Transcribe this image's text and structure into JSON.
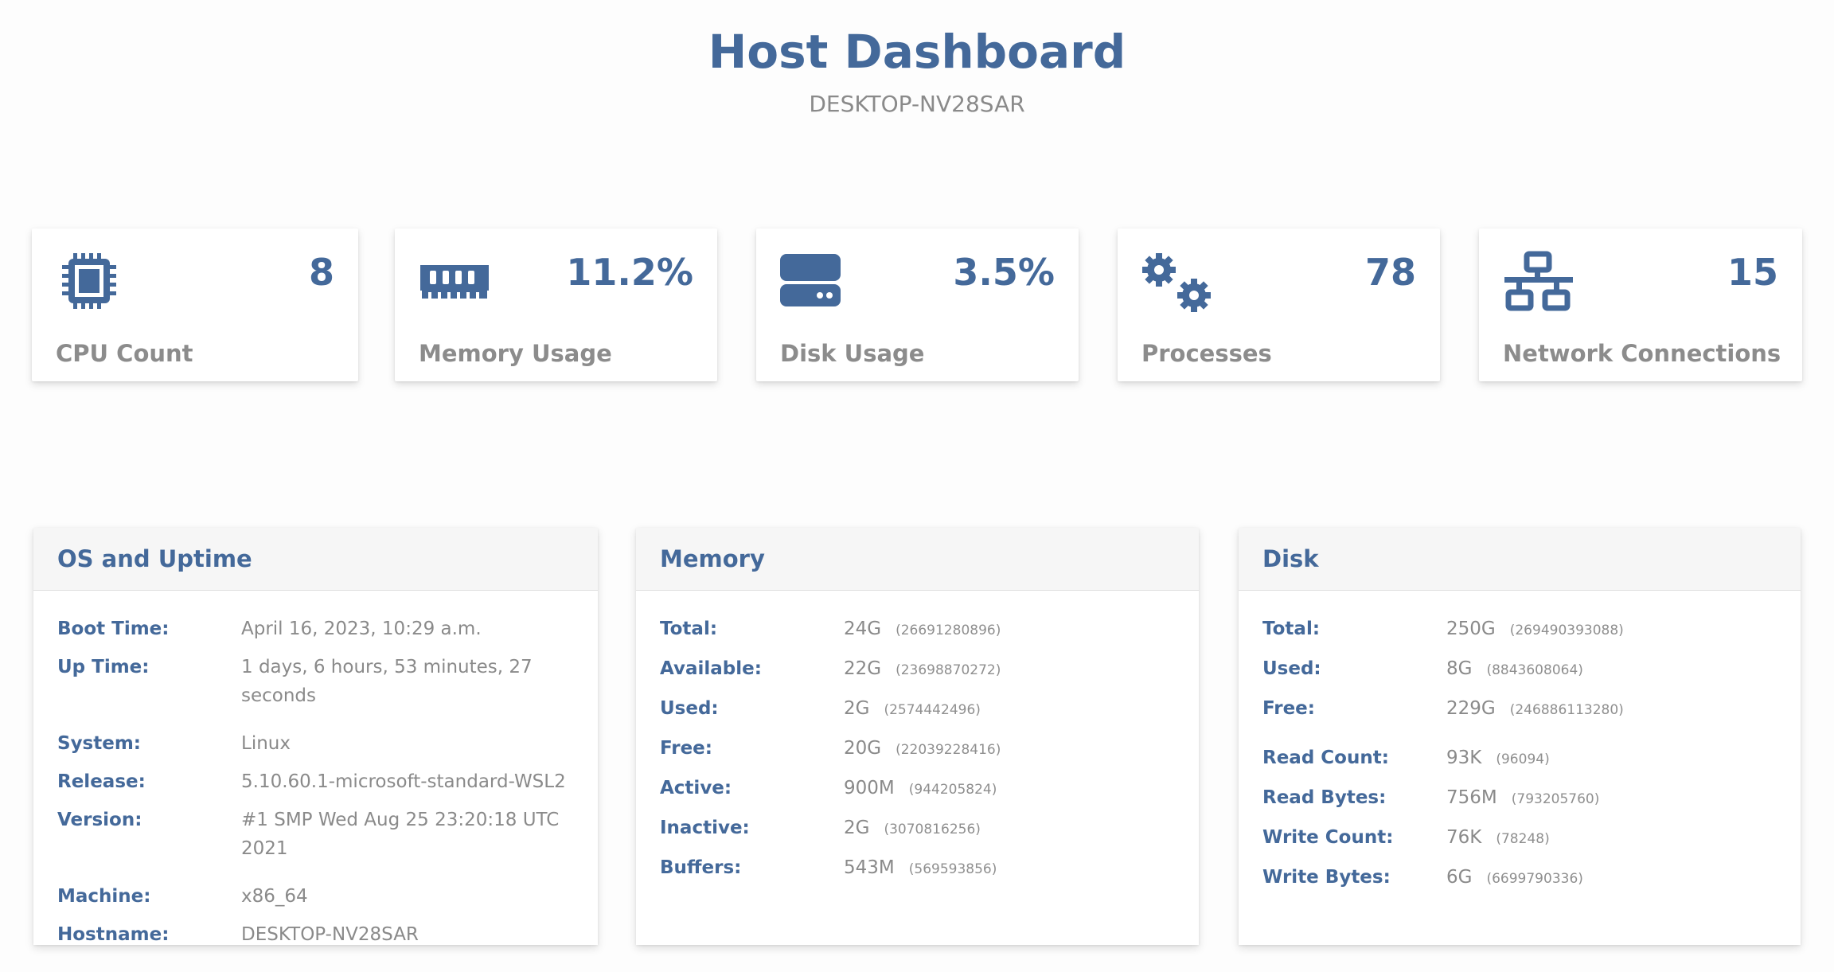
{
  "header": {
    "title": "Host Dashboard",
    "hostname": "DESKTOP-NV28SAR"
  },
  "colors": {
    "accent": "#44699a",
    "muted": "#8a8a8a"
  },
  "stats": [
    {
      "icon": "cpu-icon",
      "value": "8",
      "label": "CPU Count"
    },
    {
      "icon": "memory-icon",
      "value": "11.2%",
      "label": "Memory Usage"
    },
    {
      "icon": "hard-drive-icon",
      "value": "3.5%",
      "label": "Disk Usage"
    },
    {
      "icon": "gears-icon",
      "value": "78",
      "label": "Processes"
    },
    {
      "icon": "network-icon",
      "value": "15",
      "label": "Network Connections"
    }
  ],
  "os": {
    "title": "OS and Uptime",
    "rows": [
      {
        "label": "Boot Time:",
        "value": "April 16, 2023, 10:29 a.m."
      },
      {
        "label": "Up Time:",
        "value": "1 days, 6 hours, 53 minutes, 27 seconds"
      },
      {
        "label": "System:",
        "value": "Linux"
      },
      {
        "label": "Release:",
        "value": "5.10.60.1-microsoft-standard-WSL2"
      },
      {
        "label": "Version:",
        "value": "#1 SMP Wed Aug 25 23:20:18 UTC 2021"
      },
      {
        "label": "Machine:",
        "value": "x86_64"
      },
      {
        "label": "Hostname:",
        "value": "DESKTOP-NV28SAR"
      }
    ]
  },
  "memory": {
    "title": "Memory",
    "rows": [
      {
        "label": "Total:",
        "value": "24G",
        "raw": "(26691280896)"
      },
      {
        "label": "Available:",
        "value": "22G",
        "raw": "(23698870272)"
      },
      {
        "label": "Used:",
        "value": "2G",
        "raw": "(2574442496)"
      },
      {
        "label": "Free:",
        "value": "20G",
        "raw": "(22039228416)"
      },
      {
        "label": "Active:",
        "value": "900M",
        "raw": "(944205824)"
      },
      {
        "label": "Inactive:",
        "value": "2G",
        "raw": "(3070816256)"
      },
      {
        "label": "Buffers:",
        "value": "543M",
        "raw": "(569593856)"
      }
    ]
  },
  "disk": {
    "title": "Disk",
    "rows": [
      {
        "label": "Total:",
        "value": "250G",
        "raw": "(269490393088)"
      },
      {
        "label": "Used:",
        "value": "8G",
        "raw": "(8843608064)"
      },
      {
        "label": "Free:",
        "value": "229G",
        "raw": "(246886113280)"
      },
      {
        "label": "Read Count:",
        "value": "93K",
        "raw": "(96094)"
      },
      {
        "label": "Read Bytes:",
        "value": "756M",
        "raw": "(793205760)"
      },
      {
        "label": "Write Count:",
        "value": "76K",
        "raw": "(78248)"
      },
      {
        "label": "Write Bytes:",
        "value": "6G",
        "raw": "(6699790336)"
      }
    ]
  }
}
